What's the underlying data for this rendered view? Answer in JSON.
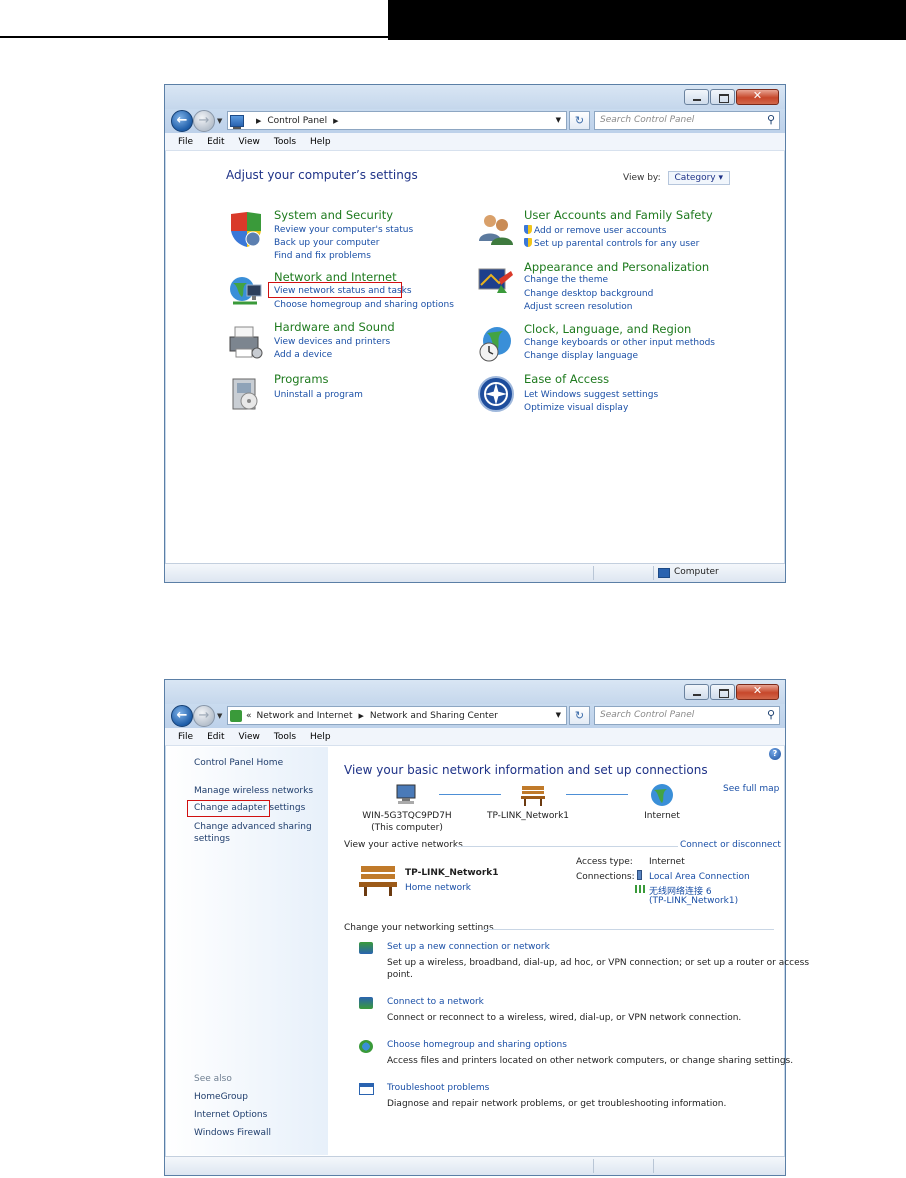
{
  "cp": {
    "address": {
      "crumb1": "Control Panel",
      "search_placeholder": "Search Control Panel"
    },
    "menu": [
      "File",
      "Edit",
      "View",
      "Tools",
      "Help"
    ],
    "heading": "Adjust your computer’s settings",
    "view_by_label": "View by:",
    "view_by_value": "Category",
    "categories_left": [
      {
        "title": "System and Security",
        "links": [
          "Review your computer's status",
          "Back up your computer",
          "Find and fix problems"
        ]
      },
      {
        "title": "Network and Internet",
        "links": [
          "View network status and tasks",
          "Choose homegroup and sharing options"
        ]
      },
      {
        "title": "Hardware and Sound",
        "links": [
          "View devices and printers",
          "Add a device"
        ]
      },
      {
        "title": "Programs",
        "links": [
          "Uninstall a program"
        ]
      }
    ],
    "categories_right": [
      {
        "title": "User Accounts and Family Safety",
        "links": [
          "Add or remove user accounts",
          "Set up parental controls for any user"
        ]
      },
      {
        "title": "Appearance and Personalization",
        "links": [
          "Change the theme",
          "Change desktop background",
          "Adjust screen resolution"
        ]
      },
      {
        "title": "Clock, Language, and Region",
        "links": [
          "Change keyboards or other input methods",
          "Change display language"
        ]
      },
      {
        "title": "Ease of Access",
        "links": [
          "Let Windows suggest settings",
          "Optimize visual display"
        ]
      }
    ],
    "status_computer": "Computer"
  },
  "nsc": {
    "address": {
      "chevrons": "«",
      "crumb1": "Network and Internet",
      "crumb2": "Network and Sharing Center",
      "search_placeholder": "Search Control Panel"
    },
    "menu": [
      "File",
      "Edit",
      "View",
      "Tools",
      "Help"
    ],
    "left": {
      "home": "Control Panel Home",
      "manage": "Manage wireless networks",
      "adapter": "Change adapter settings",
      "advanced1": "Change advanced sharing",
      "advanced2": "settings",
      "see_also": "See also",
      "homegroup": "HomeGroup",
      "internet_options": "Internet Options",
      "firewall": "Windows Firewall"
    },
    "heading": "View your basic network information and set up connections",
    "see_full_map": "See full map",
    "map": {
      "computer": "WIN-5G3TQC9PD7H",
      "computer_sub": "(This computer)",
      "network": "TP-LINK_Network1",
      "internet": "Internet"
    },
    "active_label": "View your active networks",
    "connect_disconnect": "Connect or disconnect",
    "active": {
      "name": "TP-LINK_Network1",
      "type": "Home network",
      "access_label": "Access type:",
      "access_value": "Internet",
      "connections_label": "Connections:",
      "conn1": "Local Area Connection",
      "conn2": "无线网络连接 6",
      "conn2_sub": "(TP-LINK_Network1)"
    },
    "change_label": "Change your networking settings",
    "tasks": [
      {
        "title": "Set up a new connection or network",
        "desc1": "Set up a wireless, broadband, dial-up, ad hoc, or VPN connection; or set up a router or access",
        "desc2": "point."
      },
      {
        "title": "Connect to a network",
        "desc1": "Connect or reconnect to a wireless, wired, dial-up, or VPN network connection."
      },
      {
        "title": "Choose homegroup and sharing options",
        "desc1": "Access files and printers located on other network computers, or change sharing settings."
      },
      {
        "title": "Troubleshoot problems",
        "desc1": "Diagnose and repair network problems, or get troubleshooting information."
      }
    ]
  }
}
